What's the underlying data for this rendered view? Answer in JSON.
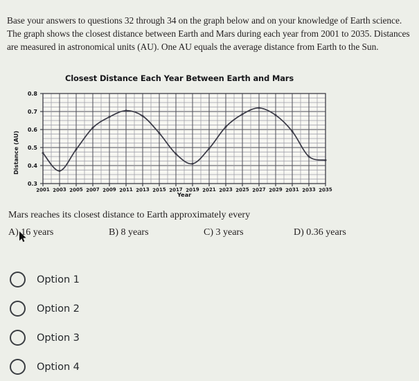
{
  "passage": {
    "text": "Base your answers to questions 32 through 34 on the graph below and on your knowledge of Earth science. The graph shows the closest distance between Earth and Mars during each year from 2001 to 2035. Distances are measured in astronomical units (AU). One AU equals the average distance from Earth to the Sun."
  },
  "question": {
    "stem": "Mars reaches its closest distance to Earth approximately every",
    "choices": [
      {
        "key": "A)",
        "label": "16 years"
      },
      {
        "key": "B)",
        "label": "8 years"
      },
      {
        "key": "C)",
        "label": "3 years"
      },
      {
        "key": "D)",
        "label": "0.36 years"
      }
    ]
  },
  "answer_options": [
    {
      "label": "Option 1",
      "selected": false
    },
    {
      "label": "Option 2",
      "selected": false
    },
    {
      "label": "Option 3",
      "selected": false
    },
    {
      "label": "Option 4",
      "selected": false
    }
  ],
  "cursor": {
    "icon": "mouse-pointer-icon"
  },
  "chart_data": {
    "type": "line",
    "title": "Closest Distance Each Year Between Earth and Mars",
    "xlabel": "Year",
    "ylabel": "Distance (AU)",
    "xlim": [
      2001,
      2035
    ],
    "ylim": [
      0.3,
      0.8
    ],
    "yticks": [
      0.3,
      0.4,
      0.5,
      0.6,
      0.7,
      0.8
    ],
    "ytick_labels": [
      "0.3",
      "0.4",
      "0.5",
      "0.6",
      "0.7",
      "0.8"
    ],
    "xticks": [
      2001,
      2003,
      2005,
      2007,
      2009,
      2011,
      2013,
      2015,
      2017,
      2019,
      2021,
      2023,
      2025,
      2027,
      2029,
      2031,
      2033,
      2035
    ],
    "xtick_labels": [
      "2001",
      "2003",
      "2005",
      "2007",
      "2009",
      "2011",
      "2013",
      "2015",
      "2017",
      "2019",
      "2021",
      "2023",
      "2025",
      "2027",
      "2029",
      "2031",
      "2033",
      "2035"
    ],
    "grid": true,
    "grid_minor_y_step": 0.025,
    "grid_minor_x_step": 1,
    "legend": null,
    "line_color": "#3a3a46",
    "marker": "dot",
    "x": [
      2001,
      2003,
      2005,
      2007,
      2009,
      2011,
      2013,
      2015,
      2017,
      2019,
      2021,
      2023,
      2025,
      2027,
      2029,
      2031,
      2033,
      2035
    ],
    "y": [
      0.47,
      0.37,
      0.49,
      0.61,
      0.67,
      0.705,
      0.675,
      0.58,
      0.465,
      0.41,
      0.495,
      0.615,
      0.685,
      0.72,
      0.68,
      0.59,
      0.45,
      0.43
    ]
  }
}
